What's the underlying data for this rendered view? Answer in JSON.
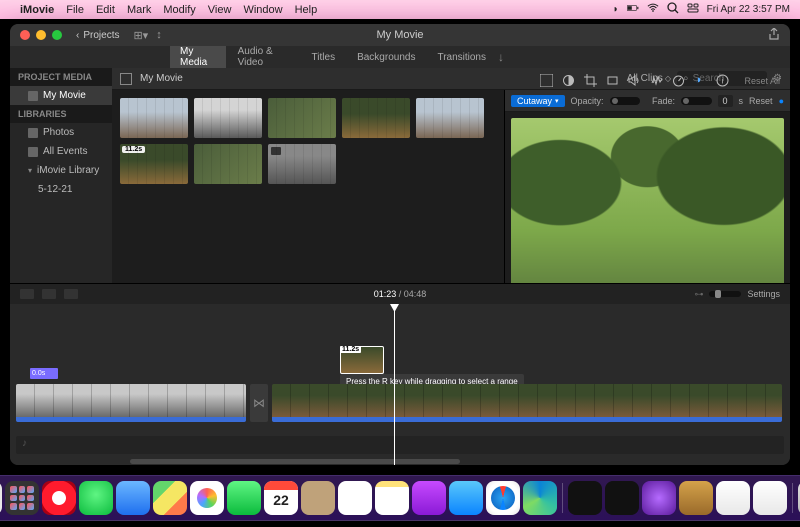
{
  "menubar": {
    "app": "iMovie",
    "items": [
      "File",
      "Edit",
      "Mark",
      "Modify",
      "View",
      "Window",
      "Help"
    ],
    "clock": "Fri Apr 22  3:57 PM"
  },
  "window": {
    "back_label": "Projects",
    "title": "My Movie"
  },
  "tabs": {
    "items": [
      "My Media",
      "Audio & Video",
      "Titles",
      "Backgrounds",
      "Transitions"
    ],
    "active": 0
  },
  "tool_strip": {
    "reset": "Reset All"
  },
  "sidebar": {
    "hdr1": "PROJECT MEDIA",
    "project": "My Movie",
    "hdr2": "LIBRARIES",
    "items": [
      "Photos",
      "All Events",
      "iMovie Library"
    ],
    "sub": "5-12-21"
  },
  "browser_hdr": {
    "name": "My Movie",
    "clips": "All Clips",
    "search_ph": "Search"
  },
  "clips": {
    "badge1": "11.2s"
  },
  "adjust": {
    "mode": "Cutaway",
    "opacity_label": "Opacity:",
    "fade_label": "Fade:",
    "fade_val": "0",
    "fade_unit": "s",
    "reset": "Reset"
  },
  "timeline": {
    "current": "01:23",
    "total": "04:48",
    "settings": "Settings",
    "marker": "0.0s",
    "pip_badge": "11.2s",
    "tooltip": "Press the R key while dragging to select a range"
  },
  "dock": {
    "cal_day": "22"
  }
}
